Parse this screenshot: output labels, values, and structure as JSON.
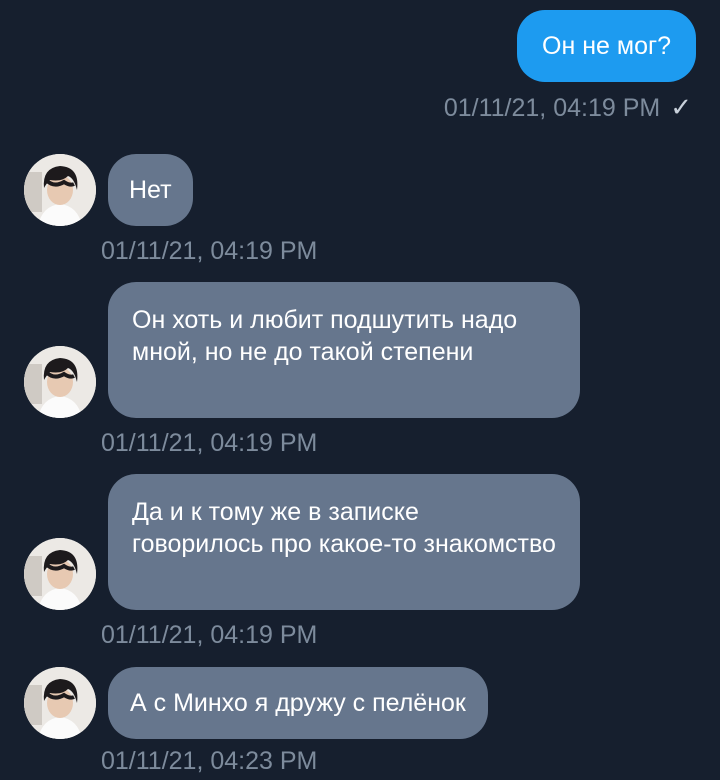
{
  "messages": [
    {
      "direction": "out",
      "text": "Он не мог?",
      "time": "01/11/21, 04:19 PM",
      "status_icon": "check-icon",
      "status_glyph": "✓"
    },
    {
      "direction": "in",
      "text": "Нет",
      "time": "01/11/21, 04:19 PM"
    },
    {
      "direction": "in",
      "text": "Он хоть и любит подшутить надо мной, но не до такой степени",
      "time": "01/11/21, 04:19 PM"
    },
    {
      "direction": "in",
      "text": "Да и к тому же в записке говорилось про какое-то знакомство",
      "time": "01/11/21, 04:19 PM"
    },
    {
      "direction": "in",
      "text": "А с Минхо я дружу с пелёнок",
      "time": "01/11/21, 04:23 PM"
    }
  ],
  "colors": {
    "background": "#161f2e",
    "outgoing_bubble": "#1d9bf0",
    "incoming_bubble": "#66768d",
    "timestamp": "#7d8b9c"
  }
}
